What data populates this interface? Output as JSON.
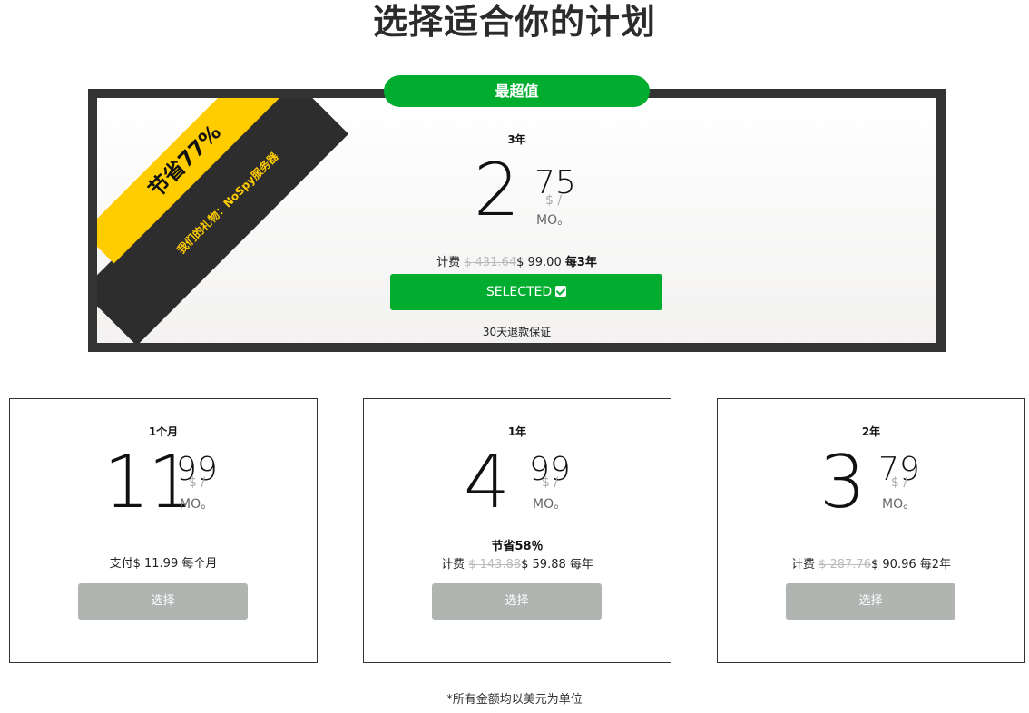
{
  "title": "选择适合你的计划",
  "featured": {
    "badge": "最超值",
    "ribbon_save": "节省77%",
    "ribbon_gift": "我们的礼物：NoSpy服务器",
    "term": "3年",
    "price_whole": "2",
    "price_cents": "75",
    "currency_per": "$ /",
    "per_unit": "MO。",
    "billing_prefix": "计费",
    "billing_old": "$ 431.64",
    "billing_new": "$ 99.00",
    "billing_period": "每3年",
    "button_label": "SELECTED",
    "guarantee": "30天退款保证"
  },
  "plans": [
    {
      "term": "1个月",
      "price_whole": "11",
      "price_cents": "99",
      "currency_per": "$ /",
      "per_unit": "MO。",
      "save": "",
      "billing_text": "支付$ 11.99 每个月",
      "button_label": "选择"
    },
    {
      "term": "1年",
      "price_whole": "4",
      "price_cents": "99",
      "currency_per": "$ /",
      "per_unit": "MO。",
      "save": "节省58％",
      "billing_prefix": "计费",
      "billing_old": "$ 143.88",
      "billing_new": "$ 59.88",
      "billing_period": "每年",
      "button_label": "选择"
    },
    {
      "term": "2年",
      "price_whole": "3",
      "price_cents": "79",
      "currency_per": "$ /",
      "per_unit": "MO。",
      "save": "",
      "billing_prefix": "计费",
      "billing_old": "$ 287.76",
      "billing_new": "$ 90.96",
      "billing_period": "每2年",
      "button_label": "选择"
    }
  ],
  "footnote": "*所有金额均以美元为单位",
  "colors": {
    "accent_green": "#00ad2f",
    "ribbon_yellow": "#ffcc00",
    "frame_dark": "#333333",
    "button_gray": "#b0b5b1"
  }
}
